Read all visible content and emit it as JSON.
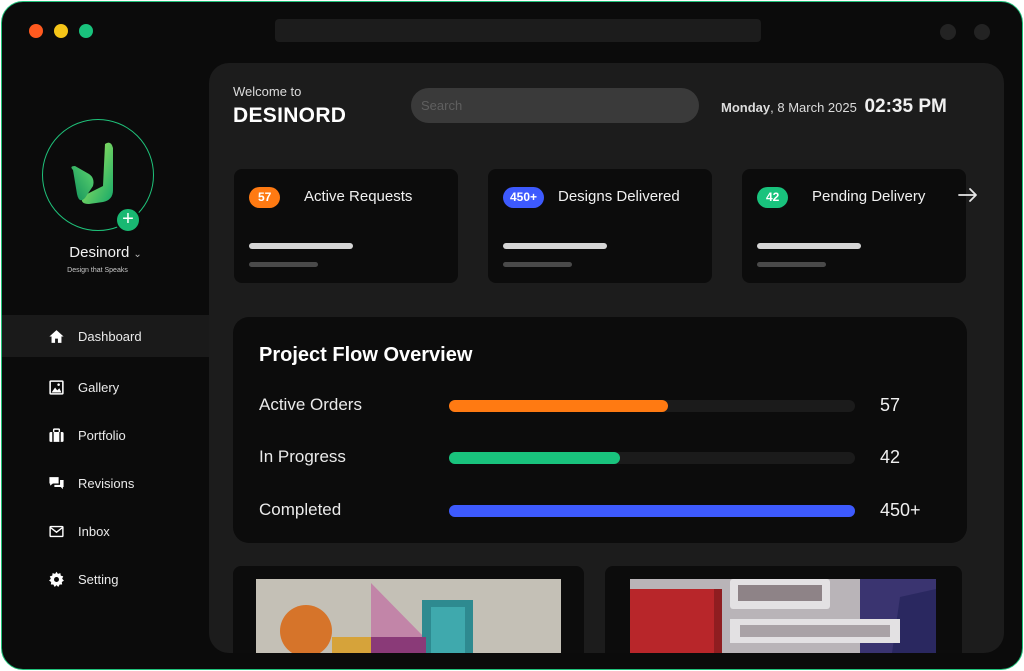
{
  "window": {
    "traffic_lights": [
      "close",
      "minimize",
      "maximize"
    ],
    "colors": {
      "accent": "#1fc27a",
      "background": "#0b0b0b",
      "panel": "#1c1c1c",
      "card": "#0c0c0c"
    }
  },
  "sidebar": {
    "brand_name": "Desinord",
    "brand_tagline": "Design that Speaks",
    "logo_icon": "desinord-logo",
    "add_icon": "plus-icon",
    "items": [
      {
        "label": "Dashboard",
        "icon": "home-icon",
        "active": true
      },
      {
        "label": "Gallery",
        "icon": "image-icon",
        "active": false
      },
      {
        "label": "Portfolio",
        "icon": "briefcase-icon",
        "active": false
      },
      {
        "label": "Revisions",
        "icon": "chat-icon",
        "active": false
      },
      {
        "label": "Inbox",
        "icon": "mail-icon",
        "active": false
      },
      {
        "label": "Setting",
        "icon": "gear-icon",
        "active": false
      }
    ]
  },
  "header": {
    "welcome": "Welcome to",
    "title": "DESINORD",
    "search_placeholder": "Search",
    "day": "Monday",
    "date": ", 8 March 2025",
    "time": "02:35 PM"
  },
  "stats": [
    {
      "badge": "57",
      "label": "Active Requests",
      "color": "#ff7a12"
    },
    {
      "badge": "450+",
      "label": "Designs Delivered",
      "color": "#3d5afe"
    },
    {
      "badge": "42",
      "label": "Pending Delivery",
      "color": "#19c37d"
    }
  ],
  "flow": {
    "title": "Project Flow Overview",
    "rows": [
      {
        "label": "Active Orders",
        "value": "57",
        "progress": 0.54,
        "color": "#ff7a12"
      },
      {
        "label": "In Progress",
        "value": "42",
        "progress": 0.42,
        "color": "#19c37d"
      },
      {
        "label": "Completed",
        "value": "450+",
        "progress": 1.0,
        "color": "#3d5afe"
      }
    ]
  }
}
